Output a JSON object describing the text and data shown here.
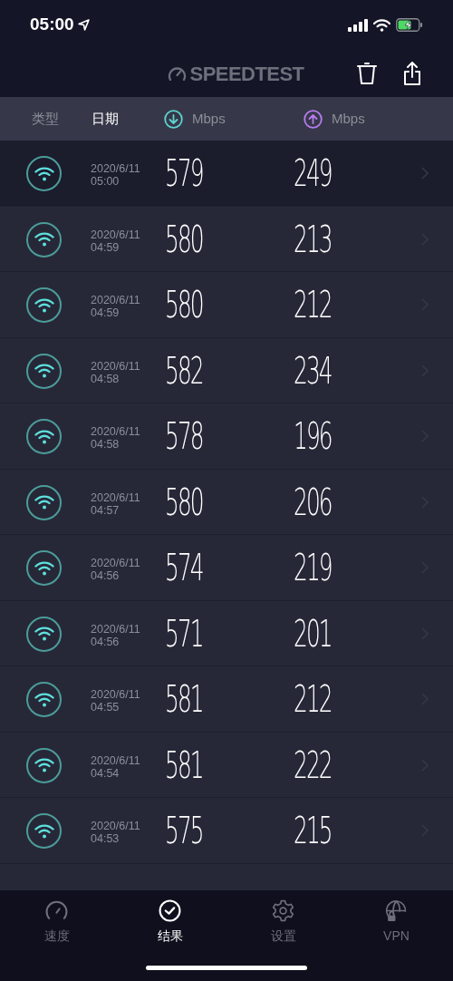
{
  "status_bar": {
    "time": "05:00"
  },
  "header": {
    "logo": "SPEEDTEST"
  },
  "table": {
    "columns": [
      {
        "label": "类型",
        "kind": "text",
        "selected": false
      },
      {
        "label": "日期",
        "kind": "text",
        "selected": true
      },
      {
        "label": "Mbps",
        "kind": "download",
        "selected": false
      },
      {
        "label": "Mbps",
        "kind": "upload",
        "selected": false
      }
    ],
    "rows": [
      {
        "date": "2020/6/11",
        "time": "05:00",
        "download": "579",
        "upload": "249",
        "selected": true
      },
      {
        "date": "2020/6/11",
        "time": "04:59",
        "download": "580",
        "upload": "213",
        "selected": false
      },
      {
        "date": "2020/6/11",
        "time": "04:59",
        "download": "580",
        "upload": "212",
        "selected": false
      },
      {
        "date": "2020/6/11",
        "time": "04:58",
        "download": "582",
        "upload": "234",
        "selected": false
      },
      {
        "date": "2020/6/11",
        "time": "04:58",
        "download": "578",
        "upload": "196",
        "selected": false
      },
      {
        "date": "2020/6/11",
        "time": "04:57",
        "download": "580",
        "upload": "206",
        "selected": false
      },
      {
        "date": "2020/6/11",
        "time": "04:56",
        "download": "574",
        "upload": "219",
        "selected": false
      },
      {
        "date": "2020/6/11",
        "time": "04:56",
        "download": "571",
        "upload": "201",
        "selected": false
      },
      {
        "date": "2020/6/11",
        "time": "04:55",
        "download": "581",
        "upload": "212",
        "selected": false
      },
      {
        "date": "2020/6/11",
        "time": "04:54",
        "download": "581",
        "upload": "222",
        "selected": false
      },
      {
        "date": "2020/6/11",
        "time": "04:53",
        "download": "575",
        "upload": "215",
        "selected": false
      }
    ]
  },
  "tab_bar": [
    {
      "label": "速度",
      "kind": "speed",
      "selected": false
    },
    {
      "label": "结果",
      "kind": "results",
      "selected": true
    },
    {
      "label": "设置",
      "kind": "settings",
      "selected": false
    },
    {
      "label": "VPN",
      "kind": "vpn",
      "selected": false
    }
  ]
}
